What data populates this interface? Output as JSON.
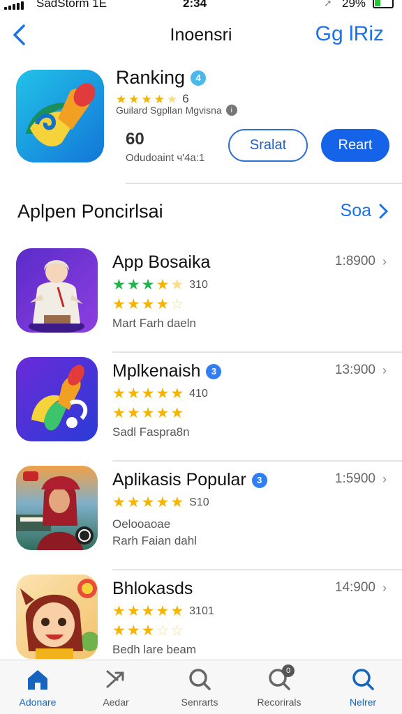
{
  "status_bar": {
    "carrier": "SadStorm  1E",
    "time": "2:34",
    "battery": "29%"
  },
  "nav": {
    "back_icon": "chevron-left-icon",
    "title": "Inoensri",
    "right_label": "Gg lRiz"
  },
  "hero": {
    "title": "Ranking",
    "badge": "4",
    "rating_count": "6",
    "subtitle": "Guilard Sgpllan Mgvisna",
    "count": "60",
    "count_label": "Odudoaint  ч'4a:1",
    "button_outline": "Sralat",
    "button_fill": "Reart",
    "colors": {
      "accent": "#1463e8"
    }
  },
  "section": {
    "title": "Aplpen Poncirlsai",
    "link": "Soa"
  },
  "apps": [
    {
      "name": "App Bosaika",
      "badge": "",
      "price": "1:8900",
      "rating_count": "310",
      "extra": "",
      "subtitle": "Mart Farh daeln",
      "icon": "girl-character-icon"
    },
    {
      "name": "Mplkenaish",
      "badge": "3",
      "price": "13:900",
      "rating_count": "410",
      "extra": "",
      "subtitle": "Sadl Faspra8n",
      "icon": "music-note-icon"
    },
    {
      "name": "Aplikasis Popular",
      "badge": "3",
      "price": "1:5900",
      "rating_count": "S10",
      "extra": "Oelooaoae",
      "subtitle": "Rarh Faian dahl",
      "icon": "woman-portrait-icon"
    },
    {
      "name": "Bhlokasds",
      "badge": "",
      "price": "14:900",
      "rating_count": "3101",
      "extra": "",
      "subtitle": "Bedh lare  beam",
      "icon": "cartoon-girl-icon"
    }
  ],
  "tabs": [
    {
      "label": "Adonare",
      "icon": "home-icon",
      "active": true
    },
    {
      "label": "Aedar",
      "icon": "trending-icon",
      "active": false
    },
    {
      "label": "Senrarts",
      "icon": "search-icon",
      "active": false
    },
    {
      "label": "Recorirals",
      "icon": "search-badge-icon",
      "badge": "0",
      "active": false
    },
    {
      "label": "Nelrer",
      "icon": "search-icon",
      "active": true
    }
  ]
}
